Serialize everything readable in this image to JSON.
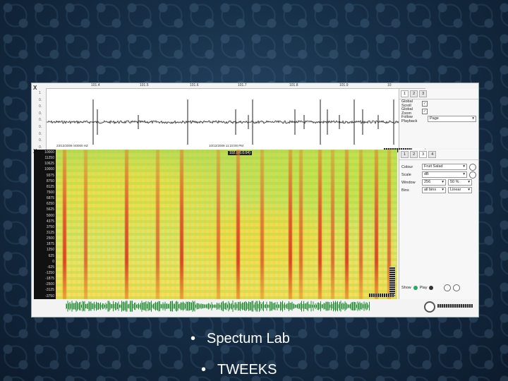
{
  "slide": {
    "bullets": [
      "Spectum Lab",
      "TWEEKS"
    ]
  },
  "app": {
    "close_glyph": "X",
    "time_ticks": [
      "101.4",
      "101.5",
      "101.6",
      "101.7",
      "101.8",
      "101.9",
      "10"
    ],
    "amp_ticks": [
      "1",
      "0.",
      "0.",
      "0.",
      "0.",
      "0.",
      "0.",
      "0.",
      "0.",
      "-1"
    ],
    "waveform_stamp_left": "23/12/2009 /40000 HZ",
    "waveform_stamp_mid": "10/12/2009 11:23:00 PM",
    "spectrogram_marker": "102.0(6.0.04)",
    "freq_ticks": [
      "10000",
      "11250",
      "10625",
      "10000",
      "9375",
      "8750",
      "8125",
      "7500",
      "6875",
      "6250",
      "5625",
      "5000",
      "4375",
      "3750",
      "3125",
      "2500",
      "1875",
      "1250",
      "625",
      "0",
      "-625",
      "-1250",
      "-1875",
      "-2500",
      "-3125",
      "-3750"
    ],
    "panel_view": {
      "tabs": [
        "1",
        "2",
        "3"
      ],
      "global_scroll_label": "Global Scroll",
      "global_zoom_label": "Global Zoom",
      "follow_playback_label": "Follow Playback",
      "follow_playback_value": "Page"
    },
    "panel_spectrogram": {
      "tabs": [
        "1",
        "2",
        "3",
        "4"
      ],
      "colour_label": "Colour",
      "colour_value": "Fruit Salad",
      "scale_label": "Scale",
      "scale_value": "dB",
      "window_label": "Window",
      "window_value": "256",
      "overlap_value": "50 %",
      "bins_label": "Bins",
      "bins_value": "all bins",
      "bins_scale_value": "Linear",
      "show_label": "Show",
      "play_label": "Play"
    },
    "colors": {
      "slide_bg": "#173049",
      "spectrogram_streak": "#d8381f",
      "waveform": "#333333",
      "green_wave": "#1f8a2e"
    }
  }
}
